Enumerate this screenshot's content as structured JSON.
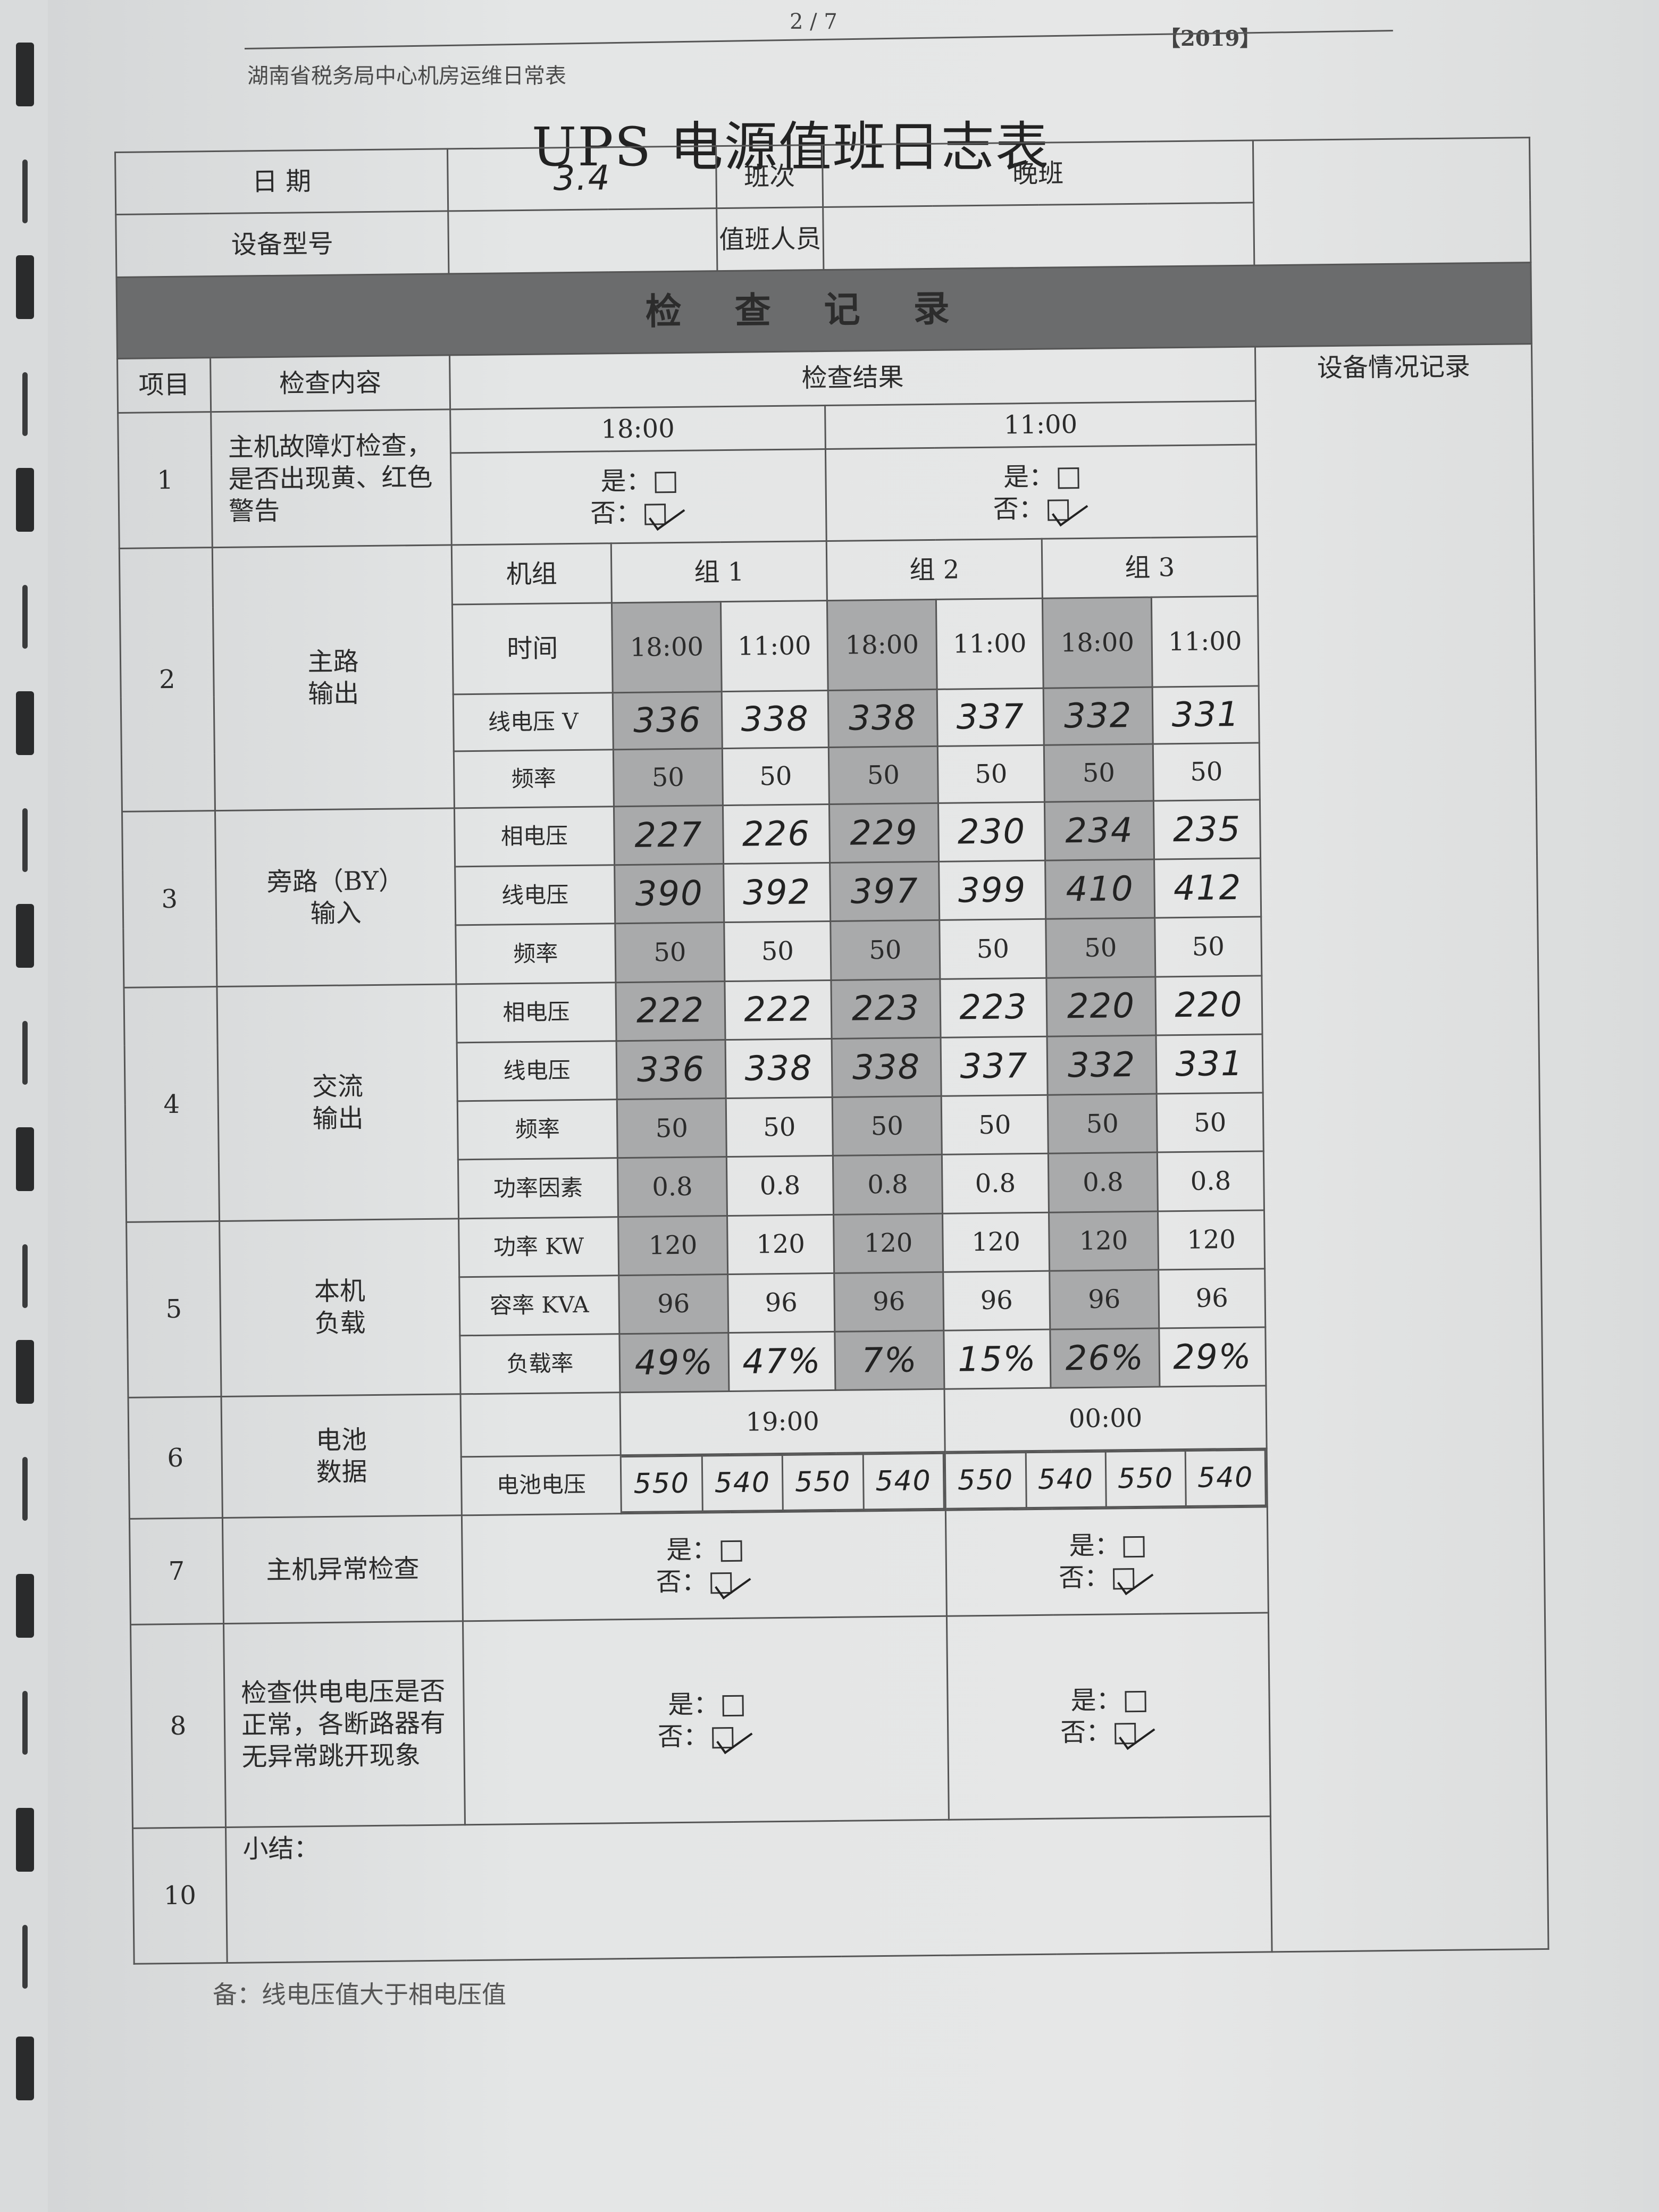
{
  "page_number": "2 / 7",
  "year_tag": "【2019】",
  "header_title": "湖南省税务局中心机房运维日常表",
  "title": "UPS 电源值班日志表",
  "info": {
    "date_label": "日 期",
    "date_value": "3.4",
    "shift_label": "班次",
    "shift_value": "晚班",
    "device_label": "设备型号",
    "device_value": "",
    "staff_label": "值班人员",
    "staff_value": ""
  },
  "banner": "检查记录",
  "columns": {
    "item": "项目",
    "content": "检查内容",
    "result": "检查结果",
    "device_record": "设备情况记录"
  },
  "row1": {
    "no": "1",
    "content": "主机故障灯检查，是否出现黄、红色警告",
    "time_a": "18:00",
    "time_b": "11:00",
    "yes": "是：",
    "no_label": "否："
  },
  "group_header": {
    "label": "机组",
    "groups": [
      "组 1",
      "组 2",
      "组 3"
    ]
  },
  "row2": {
    "no": "2",
    "content": "主路\n输出",
    "time_label": "时间",
    "times": [
      "18:00",
      "11:00",
      "18:00",
      "11:00",
      "18:00",
      "11:00"
    ],
    "line_v_label": "线电压 V",
    "line_v": [
      "336",
      "338",
      "338",
      "337",
      "332",
      "331"
    ],
    "freq_label": "频率",
    "freq": [
      "50",
      "50",
      "50",
      "50",
      "50",
      "50"
    ]
  },
  "row3": {
    "no": "3",
    "content": "旁路（BY）\n输入",
    "phase_label": "相电压",
    "phase": [
      "227",
      "226",
      "229",
      "230",
      "234",
      "235"
    ],
    "line_label": "线电压",
    "line": [
      "390",
      "392",
      "397",
      "399",
      "410",
      "412"
    ],
    "freq_label": "频率",
    "freq": [
      "50",
      "50",
      "50",
      "50",
      "50",
      "50"
    ]
  },
  "row4": {
    "no": "4",
    "content": "交流\n输出",
    "phase_label": "相电压",
    "phase": [
      "222",
      "222",
      "223",
      "223",
      "220",
      "220"
    ],
    "line_label": "线电压",
    "line": [
      "336",
      "338",
      "338",
      "337",
      "332",
      "331"
    ],
    "freq_label": "频率",
    "freq": [
      "50",
      "50",
      "50",
      "50",
      "50",
      "50"
    ],
    "pf_label": "功率因素",
    "pf": [
      "0.8",
      "0.8",
      "0.8",
      "0.8",
      "0.8",
      "0.8"
    ]
  },
  "row5": {
    "no": "5",
    "content": "本机\n负载",
    "power_label": "功率 KW",
    "power": [
      "120",
      "120",
      "120",
      "120",
      "120",
      "120"
    ],
    "capacity_label": "容率 KVA",
    "capacity": [
      "96",
      "96",
      "96",
      "96",
      "96",
      "96"
    ],
    "load_label": "负载率",
    "load": [
      "49%",
      "47%",
      "7%",
      "15%",
      "26%",
      "29%"
    ]
  },
  "row6": {
    "no": "6",
    "content": "电池\n数据",
    "time_a": "19:00",
    "time_b": "00:00",
    "battery_label": "电池电压",
    "battery": [
      "550",
      "540",
      "550",
      "540",
      "550",
      "540",
      "550",
      "540"
    ]
  },
  "row7": {
    "no": "7",
    "content": "主机异常检查",
    "yes": "是：",
    "no_label": "否："
  },
  "row8": {
    "no": "8",
    "content": "检查供电电压是否正常，各断路器有无异常跳开现象",
    "yes": "是：",
    "no_label": "否："
  },
  "row10": {
    "no": "10",
    "content": "小结："
  },
  "footnote": "备：线电压值大于相电压值"
}
